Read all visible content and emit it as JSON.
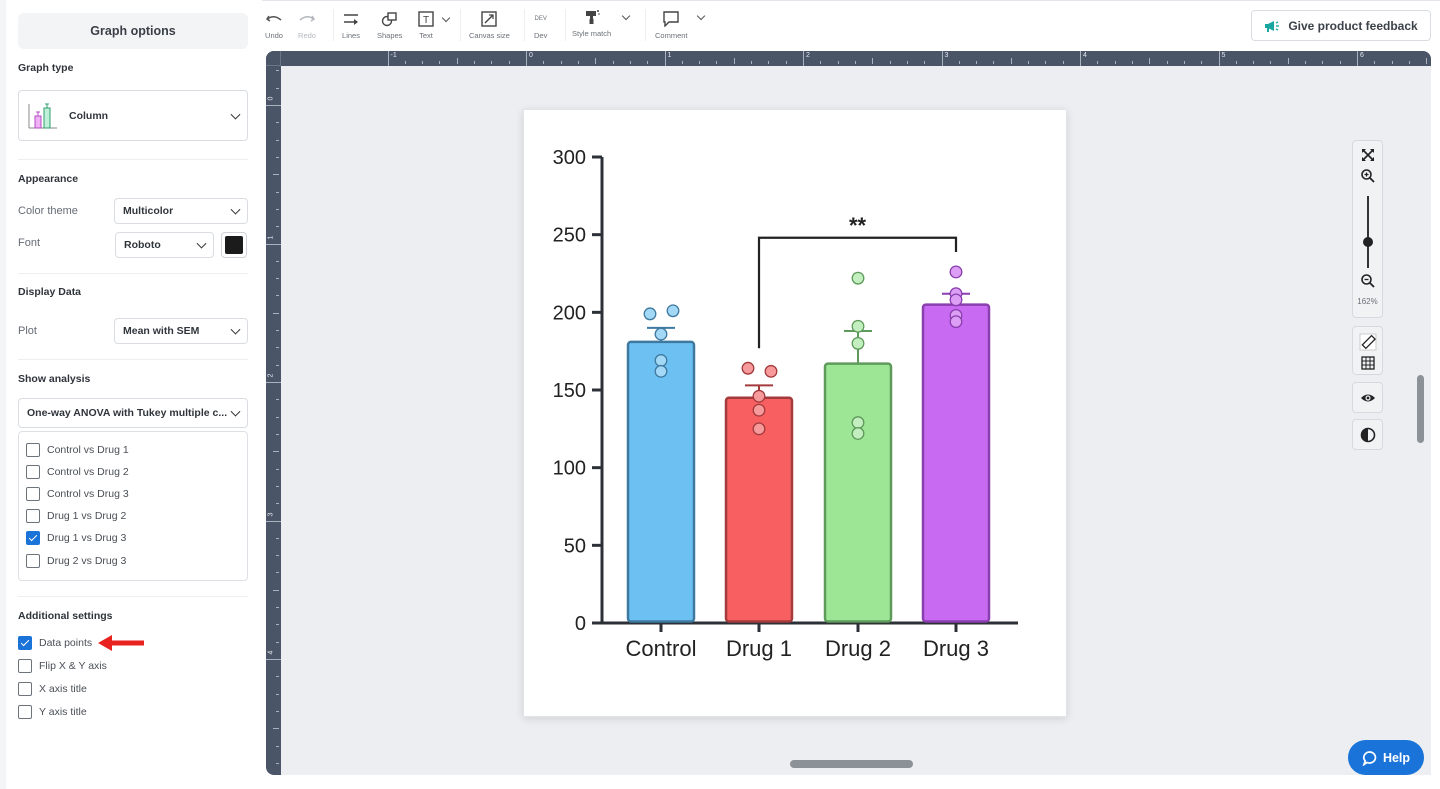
{
  "sidebar": {
    "title": "Graph options",
    "graph_type": {
      "heading": "Graph type",
      "value": "Column"
    },
    "appearance": {
      "heading": "Appearance",
      "color_theme_label": "Color theme",
      "color_theme_value": "Multicolor",
      "font_label": "Font",
      "font_value": "Roboto",
      "font_color": "#1b1b1b"
    },
    "display_data": {
      "heading": "Display Data",
      "plot_label": "Plot",
      "plot_value": "Mean with SEM"
    },
    "show_analysis": {
      "heading": "Show analysis",
      "test_value": "One-way ANOVA with Tukey multiple c...",
      "comparisons": [
        {
          "label": "Control vs Drug 1",
          "checked": false
        },
        {
          "label": "Control vs Drug 2",
          "checked": false
        },
        {
          "label": "Control vs Drug 3",
          "checked": false
        },
        {
          "label": "Drug 1 vs Drug 2",
          "checked": false
        },
        {
          "label": "Drug 1 vs Drug 3",
          "checked": true
        },
        {
          "label": "Drug 2 vs Drug 3",
          "checked": false
        }
      ]
    },
    "additional": {
      "heading": "Additional settings",
      "options": [
        {
          "label": "Data points",
          "checked": true
        },
        {
          "label": "Flip X & Y axis",
          "checked": false
        },
        {
          "label": "X axis title",
          "checked": false
        },
        {
          "label": "Y axis title",
          "checked": false
        }
      ]
    }
  },
  "toolbar": {
    "undo": "Undo",
    "redo": "Redo",
    "lines": "Lines",
    "shapes": "Shapes",
    "text": "Text",
    "canvas_size": "Canvas size",
    "dev_badge": "DEV",
    "dev": "Dev",
    "style_match": "Style match",
    "comment": "Comment",
    "feedback": "Give product feedback"
  },
  "rulers": {
    "top_labels": [
      "-1",
      "0",
      "1",
      "2",
      "3",
      "4",
      "5",
      "6"
    ],
    "left_labels": [
      "0",
      "1",
      "2",
      "3",
      "4"
    ]
  },
  "zoom": {
    "level": "162%",
    "slider_fraction": 0.6
  },
  "help": {
    "label": "Help"
  },
  "colors": {
    "accent": "#1a73d9",
    "feedback_icon": "#1aa6a0"
  },
  "chart_data": {
    "type": "bar",
    "title": "",
    "xlabel": "",
    "ylabel": "",
    "ylim": [
      0,
      300
    ],
    "yticks": [
      0,
      50,
      100,
      150,
      200,
      250,
      300
    ],
    "categories": [
      "Control",
      "Drug 1",
      "Drug 2",
      "Drug 3"
    ],
    "values": [
      181,
      145,
      167,
      205
    ],
    "sem_upper": [
      190,
      153,
      188,
      212
    ],
    "colors": [
      "#6cc1f2",
      "#f75f61",
      "#9ce696",
      "#c96bf2"
    ],
    "edge_colors": [
      "#3f79a0",
      "#a33b3d",
      "#5e9a5a",
      "#8a3fae"
    ],
    "point_colors": [
      "#a3d8f6",
      "#f79a9c",
      "#c3efc0",
      "#dd9ff6"
    ],
    "points": [
      [
        199,
        201,
        186,
        169,
        162
      ],
      [
        164,
        162,
        146,
        137,
        125
      ],
      [
        222,
        191,
        180,
        129,
        122
      ],
      [
        226,
        212,
        208,
        198,
        194
      ]
    ],
    "significance": [
      {
        "from": "Drug 1",
        "to": "Drug 3",
        "label": "**",
        "bracket_y": 248
      }
    ]
  }
}
